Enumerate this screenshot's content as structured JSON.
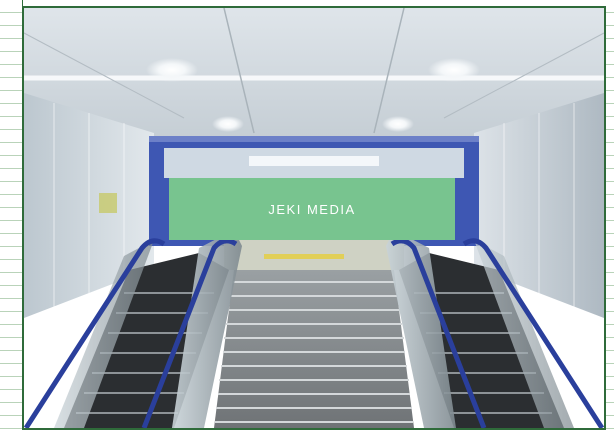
{
  "sign": {
    "text": "JEKI MEDIA",
    "color": "#78c48f"
  },
  "colors": {
    "frame": "#2f6b3a",
    "rule_lines": "#b9d3b9",
    "handrail": "#2a3f9c"
  },
  "icons": {
    "photo": "escalator-stairs-photo"
  }
}
